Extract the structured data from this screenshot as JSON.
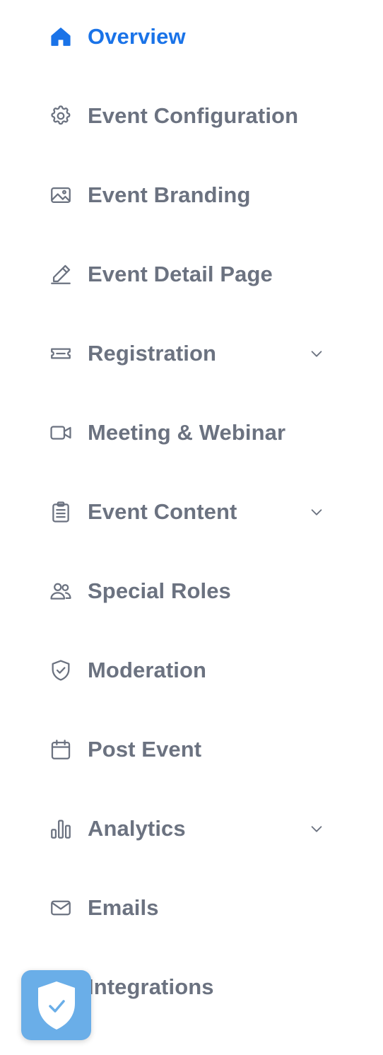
{
  "accent_color": "#1a73e8",
  "text_color": "#6b7280",
  "nav": {
    "items": [
      {
        "label": "Overview",
        "icon": "home-icon",
        "active": true,
        "expandable": false
      },
      {
        "label": "Event Configuration",
        "icon": "gear-icon",
        "active": false,
        "expandable": false
      },
      {
        "label": "Event Branding",
        "icon": "image-icon",
        "active": false,
        "expandable": false
      },
      {
        "label": "Event Detail Page",
        "icon": "pencil-icon",
        "active": false,
        "expandable": false
      },
      {
        "label": "Registration",
        "icon": "ticket-icon",
        "active": false,
        "expandable": true
      },
      {
        "label": "Meeting & Webinar",
        "icon": "video-camera-icon",
        "active": false,
        "expandable": false
      },
      {
        "label": "Event Content",
        "icon": "clipboard-icon",
        "active": false,
        "expandable": true
      },
      {
        "label": "Special Roles",
        "icon": "users-icon",
        "active": false,
        "expandable": false
      },
      {
        "label": "Moderation",
        "icon": "shield-check-icon",
        "active": false,
        "expandable": false
      },
      {
        "label": "Post Event",
        "icon": "calendar-icon",
        "active": false,
        "expandable": false
      },
      {
        "label": "Analytics",
        "icon": "bar-chart-icon",
        "active": false,
        "expandable": true
      },
      {
        "label": "Emails",
        "icon": "mail-icon",
        "active": false,
        "expandable": false
      },
      {
        "label": "Integrations",
        "icon": "integrations-icon",
        "active": false,
        "expandable": false
      }
    ]
  },
  "security_badge": {
    "icon": "shield-check-icon",
    "color": "#6aaee8"
  }
}
